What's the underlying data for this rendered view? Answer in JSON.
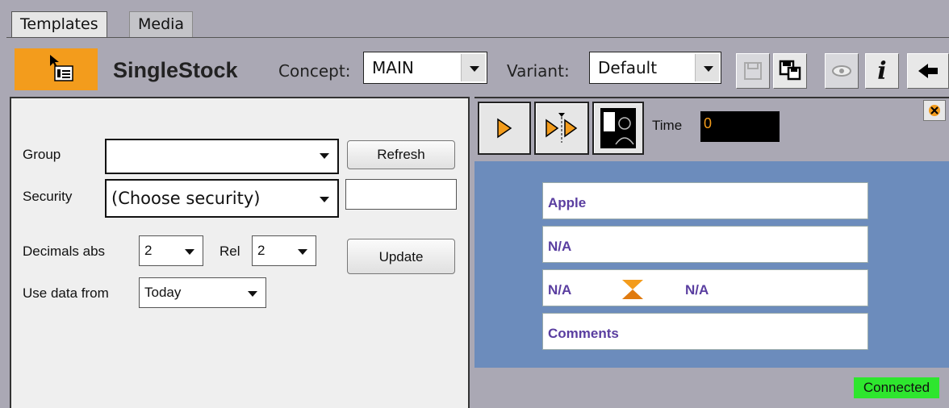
{
  "tabs": [
    {
      "label": "Templates",
      "active": true
    },
    {
      "label": "Media",
      "active": false
    }
  ],
  "header": {
    "template_name": "SingleStock",
    "concept_label": "Concept:",
    "concept_value": "MAIN",
    "variant_label": "Variant:",
    "variant_value": "Default",
    "toolbar_icons": [
      "save-icon",
      "save-as-icon",
      "preview-eye-icon",
      "info-icon",
      "back-arrow-icon"
    ],
    "info_glyph": "i"
  },
  "form": {
    "group_label": "Group",
    "group_value": "",
    "refresh_label": "Refresh",
    "security_label": "Security",
    "security_value": "(Choose security)",
    "security_text": "",
    "decimals_abs_label": "Decimals abs",
    "decimals_abs_value": "2",
    "rel_label": "Rel",
    "rel_value": "2",
    "update_label": "Update",
    "use_data_label": "Use data from",
    "use_data_value": "Today"
  },
  "preview": {
    "time_label": "Time",
    "time_value": "0",
    "fields": {
      "name": "Apple",
      "value": "N/A",
      "change_left": "N/A",
      "change_right": "N/A",
      "comments": "Comments"
    }
  },
  "status": {
    "connection": "Connected",
    "connection_color": "#2ee62e"
  },
  "colors": {
    "accent": "#f39c1c",
    "preview_bg": "#6c8cbc",
    "field_text": "#5a3ea0"
  }
}
